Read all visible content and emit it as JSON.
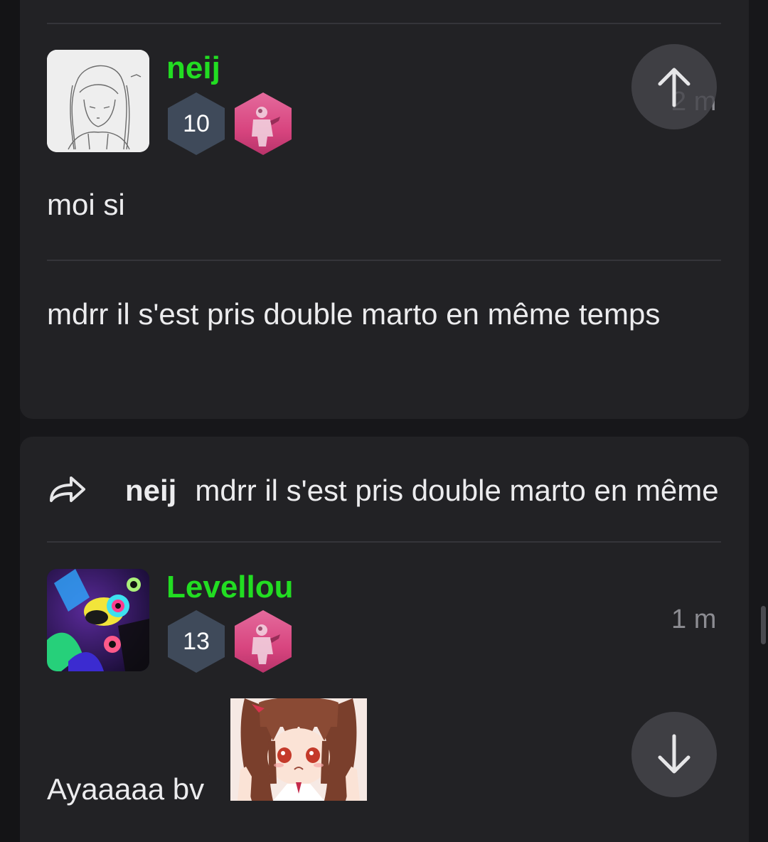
{
  "messages": [
    {
      "username": "neij",
      "level": "10",
      "time": "2 m",
      "body": "moi si",
      "avatar_icon": "sketch-girl-avatar",
      "username_color": "#22dd22"
    },
    {
      "body": "mdrr il s'est pris double marto en même temps"
    },
    {
      "reply_to": {
        "username": "neij",
        "text": "mdrr il s'est pris double marto en même temps"
      },
      "username": "Levellou",
      "level": "13",
      "time": "1 m",
      "body": "Ayaaaaa bv",
      "avatar_icon": "neon-clown-avatar",
      "sticker": "anime-girl-sticker"
    }
  ],
  "controls": {
    "scroll_up_icon": "arrow-up-icon",
    "scroll_down_icon": "arrow-down-icon",
    "reply_icon": "reply-arrow-icon"
  },
  "colors": {
    "background": "#17171a",
    "card": "#222225",
    "username": "#22dd22",
    "level_badge": "#3f4a5a",
    "role_badge": "#d8457f"
  }
}
